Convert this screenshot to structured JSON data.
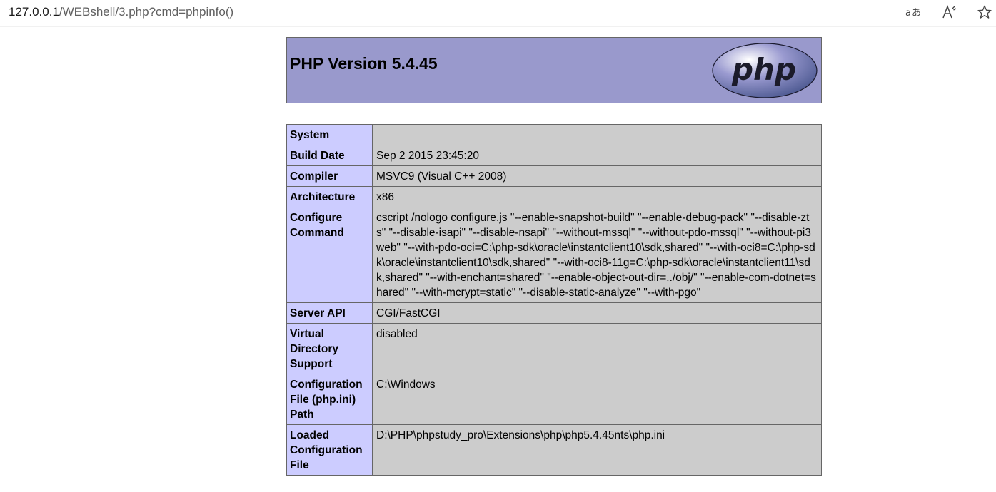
{
  "browser": {
    "url_host": "127.0.0.1",
    "url_path": "/WEBshell/3.php?cmd=phpinfo()",
    "icons": {
      "translate": "translate-icon",
      "read_aloud": "read-aloud-icon",
      "favorite": "star-icon"
    }
  },
  "phpinfo": {
    "title": "PHP Version 5.4.45",
    "logo_text": "php",
    "colors": {
      "header_bg": "#9999cc",
      "key_bg": "#ccccff",
      "value_bg": "#cccccc",
      "border": "#666666"
    },
    "rows": [
      {
        "key": "System",
        "value": ""
      },
      {
        "key": "Build Date",
        "value": "Sep 2 2015 23:45:20"
      },
      {
        "key": "Compiler",
        "value": "MSVC9 (Visual C++ 2008)"
      },
      {
        "key": "Architecture",
        "value": "x86"
      },
      {
        "key": "Configure Command",
        "value": "cscript /nologo configure.js \"--enable-snapshot-build\" \"--enable-debug-pack\" \"--disable-zts\" \"--disable-isapi\" \"--disable-nsapi\" \"--without-mssql\" \"--without-pdo-mssql\" \"--without-pi3web\" \"--with-pdo-oci=C:\\php-sdk\\oracle\\instantclient10\\sdk,shared\" \"--with-oci8=C:\\php-sdk\\oracle\\instantclient10\\sdk,shared\" \"--with-oci8-11g=C:\\php-sdk\\oracle\\instantclient11\\sdk,shared\" \"--with-enchant=shared\" \"--enable-object-out-dir=../obj/\" \"--enable-com-dotnet=shared\" \"--with-mcrypt=static\" \"--disable-static-analyze\" \"--with-pgo\""
      },
      {
        "key": "Server API",
        "value": "CGI/FastCGI"
      },
      {
        "key": "Virtual Directory Support",
        "value": "disabled"
      },
      {
        "key": "Configuration File (php.ini) Path",
        "value": "C:\\Windows"
      },
      {
        "key": "Loaded Configuration File",
        "value": "D:\\PHP\\phpstudy_pro\\Extensions\\php\\php5.4.45nts\\php.ini"
      }
    ]
  }
}
